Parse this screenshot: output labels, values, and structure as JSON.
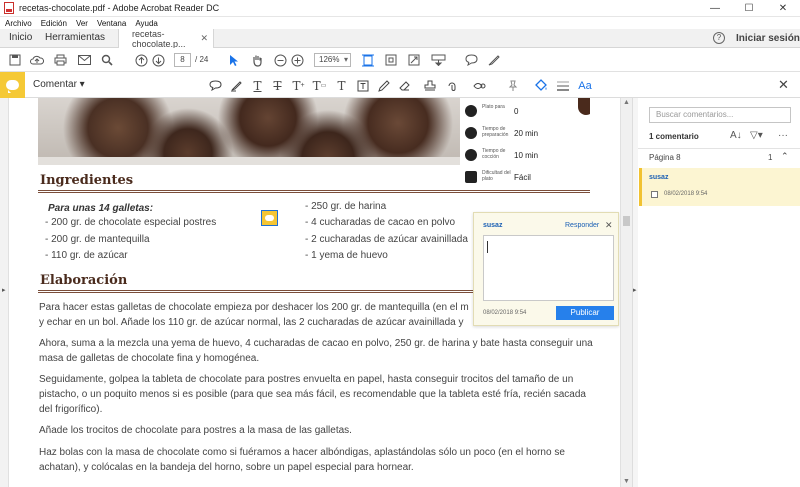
{
  "window": {
    "title": "recetas-chocolate.pdf - Adobe Acrobat Reader DC",
    "controls": {
      "minimize": "—",
      "maximize": "☐",
      "close": "✕"
    }
  },
  "menu": [
    "Archivo",
    "Edición",
    "Ver",
    "Ventana",
    "Ayuda"
  ],
  "tabs": {
    "home": "Inicio",
    "tools": "Herramientas",
    "document": "recetas-chocolate.p...",
    "close": "✕",
    "help": "?",
    "signin": "Iniciar sesión"
  },
  "toolbar": {
    "page_current": "8",
    "page_total": "/ 24",
    "zoom": "126%",
    "icons": [
      "save-icon",
      "upload-icon",
      "print-icon",
      "email-icon",
      "search-icon",
      "page-up-icon",
      "page-down-icon",
      "select-cursor-icon",
      "hand-icon",
      "zoom-out-icon",
      "zoom-in-icon",
      "fit-page-icon",
      "full-screen-icon",
      "fit-width-icon",
      "keyboard-icon",
      "comment-icon",
      "sign-icon"
    ]
  },
  "comment_toolbar": {
    "label": "Comentar ▾",
    "close": "✕"
  },
  "recipe": {
    "info": [
      {
        "label": "Plato para",
        "value": "0"
      },
      {
        "label": "Tiempo de preparación",
        "value": "20 min"
      },
      {
        "label": "Tiempo de cocción",
        "value": "10 min"
      },
      {
        "label": "Dificultad del plato",
        "value": "Fácil"
      }
    ],
    "ingredients_heading": "Ingredientes",
    "ingredients_subtitle": "Para unas 14 galletas:",
    "ingredients_left": [
      "- 200 gr. de chocolate especial postres",
      "- 200 gr. de mantequilla",
      "- 110 gr. de azúcar"
    ],
    "ingredients_right": [
      "- 250 gr. de harina",
      "- 4 cucharadas de cacao en polvo",
      "- 2 cucharadas de azúcar avainillada",
      "- 1 yema de huevo"
    ],
    "method_heading": "Elaboración",
    "paragraphs": [
      "Para hacer estas galletas de chocolate empieza por deshacer los 200 gr. de mantequilla (en el m y echar en un bol. Añade los 110 gr. de azúcar normal, las 2 cucharadas de azúcar avainillada y",
      "Ahora, suma a la mezcla una yema de huevo, 4 cucharadas de cacao en polvo, 250 gr. de harina y bate hasta conseguir una masa de galletas de chocolate fina y homogénea.",
      "Seguidamente, golpea la tableta de chocolate para postres envuelta en papel, hasta conseguir trocitos del tamaño de un pistacho, o un poquito menos si es posible (para que sea más fácil, es recomendable que la tableta esté fría, recién sacada del frigorífico).",
      "Añade los trocitos de chocolate para postres a la masa de las galletas.",
      "Haz bolas con la masa de chocolate como si fuéramos a hacer albóndigas, aplastándolas sólo un poco (en el horno se achatan), y colócalas en la bandeja del horno, sobre un papel especial para hornear."
    ]
  },
  "popup": {
    "author": "susaz",
    "reply": "Responder",
    "close": "✕",
    "text_value": "",
    "date": "08/02/2018  9:54",
    "publish": "Publicar"
  },
  "panel": {
    "search_placeholder": "Buscar comentarios...",
    "count": "1 comentario",
    "page_label": "Página 8",
    "page_count": "1",
    "comment": {
      "author": "susaz",
      "date": "08/02/2018  9:54"
    }
  }
}
